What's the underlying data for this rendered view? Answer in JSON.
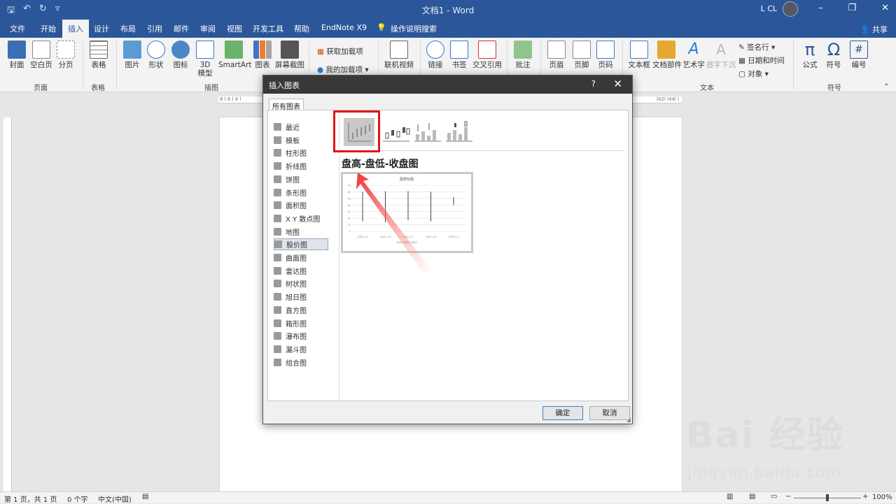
{
  "window": {
    "title": "文档1 - Word",
    "user": "L CL",
    "min": "–",
    "restore": "❐",
    "close": "✕"
  },
  "qat": {
    "save": "🖫",
    "undo": "↶",
    "redo": "↻",
    "more": "▿"
  },
  "tabs": [
    "文件",
    "开始",
    "插入",
    "设计",
    "布局",
    "引用",
    "邮件",
    "审阅",
    "视图",
    "开发工具",
    "帮助",
    "EndNote X9"
  ],
  "tell_me": "操作说明搜索",
  "share": "共享",
  "ribbon": {
    "cover": "封面",
    "blank_page": "空白页",
    "page_break": "分页",
    "group_pages": "页面",
    "table": "表格",
    "group_table": "表格",
    "picture": "图片",
    "shapes": "形状",
    "icons": "图标",
    "model3d": "3D 模型",
    "smartart": "SmartArt",
    "chart": "图表",
    "screenshot": "屏幕截图",
    "group_illus": "插图",
    "get_addins": "获取加载项",
    "my_addins": "我的加载项",
    "online_video": "联机视频",
    "link": "链接",
    "bookmark": "书签",
    "crossref": "交叉引用",
    "comment": "批注",
    "header": "页眉",
    "footer": "页脚",
    "page_number": "页码",
    "textbox": "文本框",
    "quickparts": "文档部件",
    "wordart": "艺术字",
    "dropcap": "首字下沉",
    "signature": "签名行",
    "datetime": "日期和时间",
    "object": "对象",
    "group_text": "文本",
    "equation": "公式",
    "symbol": "符号",
    "number": "编号",
    "group_symbols": "符号",
    "equation_glyph": "π",
    "symbol_glyph": "Ω",
    "number_glyph": "#"
  },
  "ruler": {
    "left_ticks": "8 l 6 l 4 l",
    "right_ticks": "l42l l44l l"
  },
  "dialog": {
    "title": "插入图表",
    "help": "?",
    "close": "✕",
    "tab": "所有图表",
    "categories": [
      "最近",
      "模板",
      "柱形图",
      "折线图",
      "饼图",
      "条形图",
      "面积图",
      "X Y 散点图",
      "地图",
      "股价图",
      "曲面图",
      "雷达图",
      "树状图",
      "旭日图",
      "直方图",
      "箱形图",
      "瀑布图",
      "漏斗图",
      "组合图"
    ],
    "selected_category": "股价图",
    "chart_name": "盘高-盘低-收盘图",
    "preview": {
      "title": "图表标题",
      "y_ticks": [
        "70",
        "60",
        "50",
        "40",
        "30",
        "20",
        "10",
        "0"
      ],
      "x_ticks": [
        "2002-1-5",
        "2002-1-6",
        "2002-1-7",
        "2002-1-8",
        "2002-1-9"
      ],
      "legend": "系列1  系列2  系列3"
    },
    "ok": "确定",
    "cancel": "取消"
  },
  "status": {
    "page": "第 1 页，共 1 页",
    "words": "0 个字",
    "lang": "中文(中国)",
    "zoom": "100%",
    "minus": "−",
    "plus": "+"
  },
  "watermark": {
    "main": "Bai 经验",
    "sub": "jingyan.baidu.com"
  }
}
